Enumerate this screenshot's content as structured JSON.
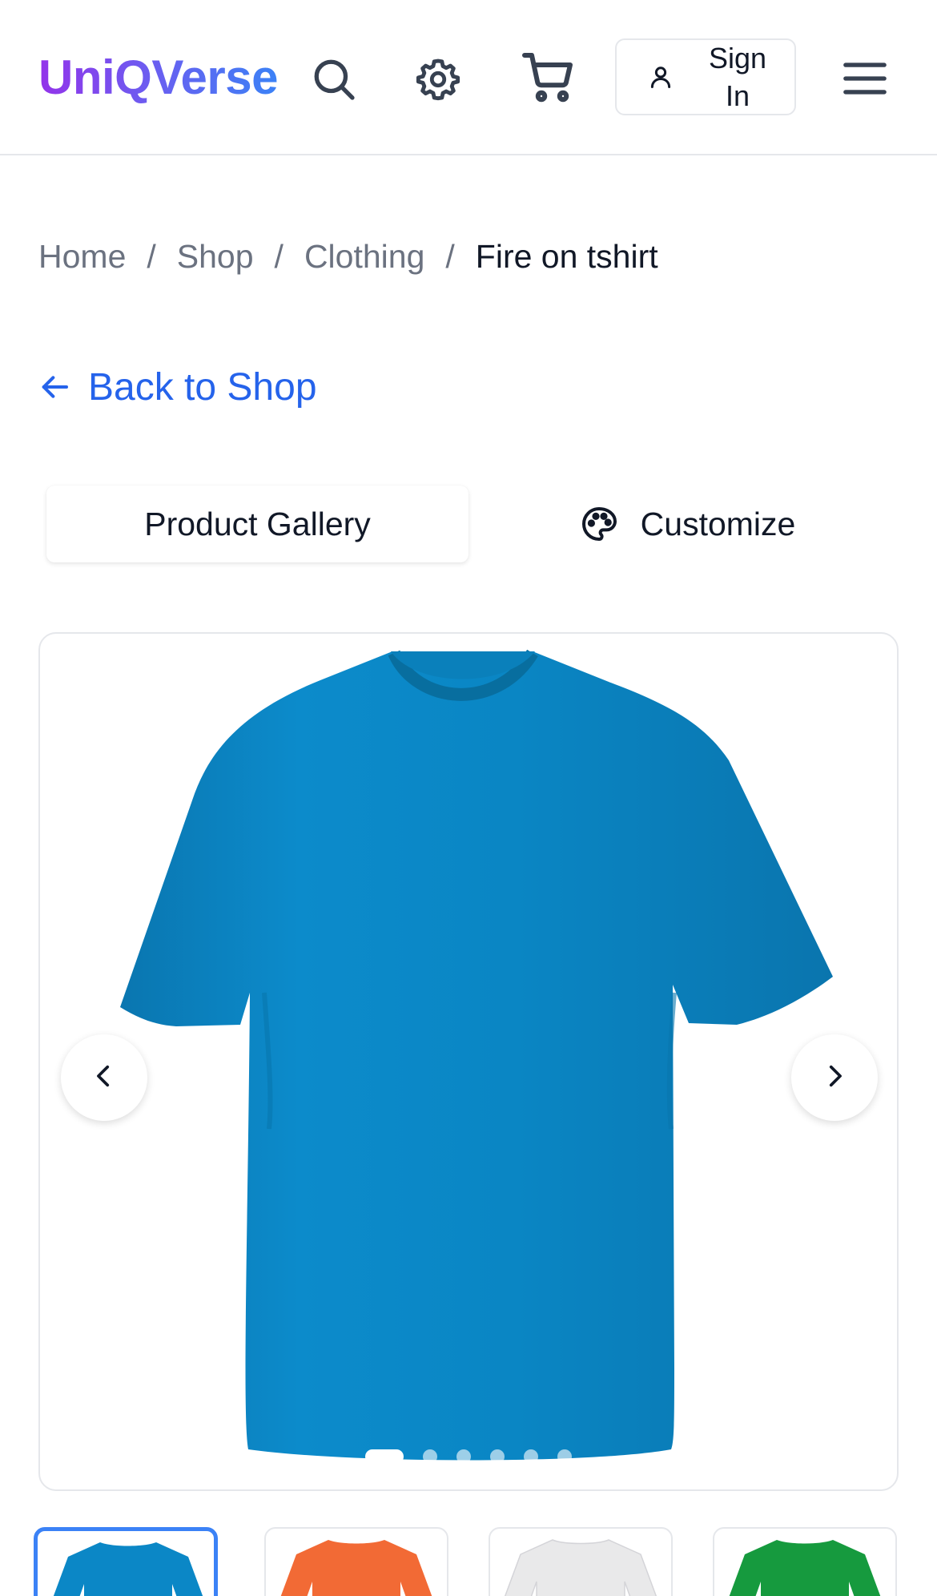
{
  "header": {
    "brand": "UniQVerse",
    "icons": [
      "search-icon",
      "gear-icon",
      "cart-icon",
      "user-icon",
      "menu-icon"
    ],
    "signin_label": "Sign In",
    "brand_gradient": [
      "#9333ea",
      "#3b82f6"
    ]
  },
  "breadcrumb": {
    "items": [
      "Home",
      "Shop",
      "Clothing"
    ],
    "separator": "/",
    "current": "Fire on tshirt"
  },
  "back_link": {
    "label": "Back to Shop",
    "color": "#2563eb"
  },
  "tabs": [
    {
      "label": "Product Gallery",
      "active": true
    },
    {
      "label": "Customize",
      "active": false,
      "icon": "palette-icon"
    }
  ],
  "gallery": {
    "main_shirt_color": "#0b87c6",
    "dot_count": 6,
    "active_dot": 0
  },
  "thumbnails": [
    {
      "color": "#0b87c6",
      "selected": true
    },
    {
      "color": "#f26a35",
      "selected": false
    },
    {
      "color": "#e9e9ea",
      "selected": false
    },
    {
      "color": "#169a3e",
      "selected": false
    }
  ]
}
